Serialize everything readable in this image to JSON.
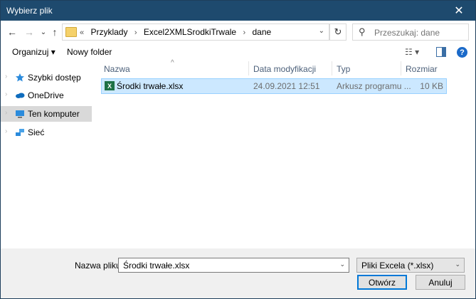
{
  "window": {
    "title": "Wybierz plik",
    "close_glyph": "✕"
  },
  "navbar": {
    "back_glyph": "←",
    "forward_glyph": "→",
    "recent_glyph": "⌄",
    "up_glyph": "↑",
    "breadcrumb_prefix": "«",
    "breadcrumb": [
      "Przyklady",
      "Excel2XMLSrodkiTrwale",
      "dane"
    ],
    "breadcrumb_sep": "›",
    "refresh_glyph": "↻",
    "search_placeholder": "Przeszukaj: dane"
  },
  "toolbar": {
    "organize_label": "Organizuj",
    "organize_caret": "▾",
    "new_folder_label": "Nowy folder",
    "help_glyph": "?"
  },
  "sidebar": {
    "items": [
      {
        "label": "Szybki dostęp",
        "icon": "star-icon"
      },
      {
        "label": "OneDrive",
        "icon": "cloud-icon"
      },
      {
        "label": "Ten komputer",
        "icon": "computer-icon",
        "selected": true
      },
      {
        "label": "Sieć",
        "icon": "network-icon"
      }
    ]
  },
  "file_list": {
    "columns": [
      "Nazwa",
      "Data modyfikacji",
      "Typ",
      "Rozmiar"
    ],
    "rows": [
      {
        "name": "Środki trwałe.xlsx",
        "modified": "24.09.2021 12:51",
        "type": "Arkusz programu ...",
        "size": "10 KB",
        "icon": "excel-file-icon"
      }
    ]
  },
  "footer": {
    "filename_label": "Nazwa pliku:",
    "filename_value": "Środki trwałe.xlsx",
    "filetype_value": "Pliki Excela (*.xlsx)",
    "open_label": "Otwórz",
    "cancel_label": "Anuluj"
  },
  "colors": {
    "titlebar": "#1e4a6e",
    "selection": "#cce8ff",
    "accent": "#0078d7"
  }
}
